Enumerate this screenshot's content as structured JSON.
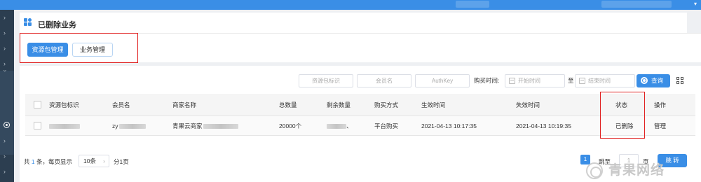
{
  "page": {
    "title": "已删除业务"
  },
  "tabs": [
    {
      "label": "资源包管理",
      "active": true
    },
    {
      "label": "业务管理",
      "active": false
    }
  ],
  "filters": {
    "package_id_placeholder": "资源包标识",
    "member_placeholder": "会员名",
    "authkey_placeholder": "AuthKey",
    "purchase_time_label": "购买时间:",
    "start_time_placeholder": "开始时间",
    "range_separator": "至",
    "end_time_placeholder": "结束时间",
    "search_label": "查询"
  },
  "table": {
    "columns": [
      "资源包标识",
      "会员名",
      "商家名称",
      "总数量",
      "剩余数量",
      "购买方式",
      "生效时间",
      "失效时间",
      "状态",
      "操作"
    ],
    "rows": [
      {
        "member_prefix": "zy",
        "merchant_prefix": "青果云商家",
        "total": "20000个",
        "remaining_suffix": "、",
        "purchase_method": "平台购买",
        "effective_time": "2021-04-13 10:17:35",
        "expire_time": "2021-04-13 10:19:35",
        "status": "已删除",
        "action": "管理"
      }
    ]
  },
  "pagination": {
    "total_prefix": "共",
    "total_count": "1",
    "total_suffix": "条，每页显示",
    "page_size": "10条",
    "pages_text": "分1页",
    "current_page": "1",
    "jump_prefix": "跳至",
    "jump_value": "1",
    "jump_suffix": "页",
    "jump_button": "跳 转"
  },
  "watermark": {
    "text": "青果网络"
  },
  "colors": {
    "primary": "#3a8ee6",
    "deleted_status": "#e04848",
    "highlight_box": "#e02020",
    "sidebar": "#2c3e50"
  },
  "icons": {
    "header": "apps-grid-icon",
    "calendar": "calendar-icon",
    "search": "search-icon",
    "column_settings": "grid-settings-icon"
  }
}
